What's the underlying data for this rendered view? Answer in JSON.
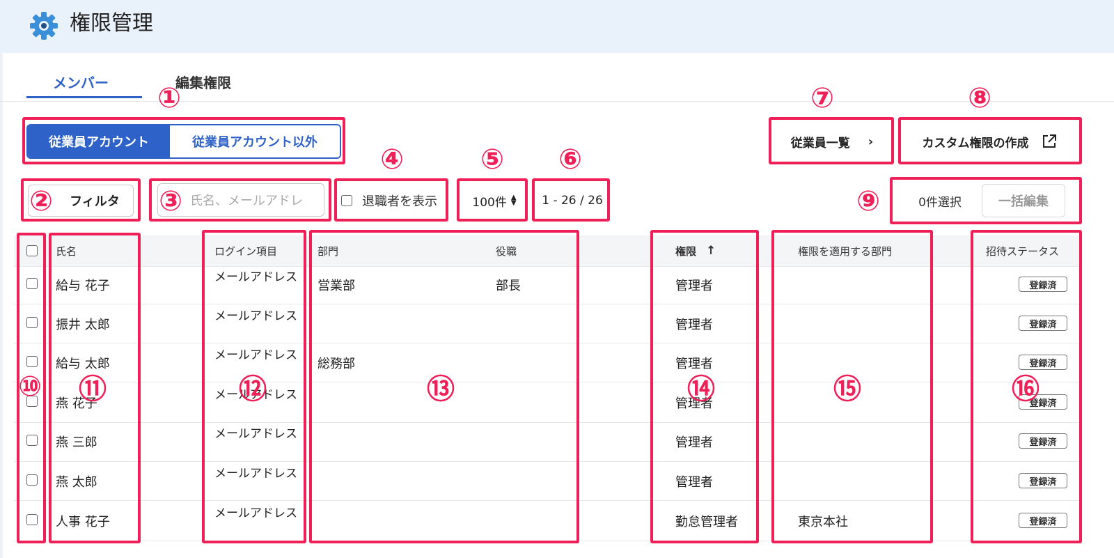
{
  "header": {
    "title": "権限管理",
    "icon": "gear-icon"
  },
  "tabs": [
    {
      "label": "メンバー",
      "active": true
    },
    {
      "label": "編集権限",
      "active": false
    }
  ],
  "account_toggle": {
    "options": [
      "従業員アカウント",
      "従業員アカウント以外"
    ],
    "selected": "従業員アカウント"
  },
  "toolbar": {
    "filter_label": "フィルタ",
    "search_placeholder": "氏名、メールアドレ",
    "show_retired_label": "退職者を表示",
    "per_page": "100件",
    "range": "1 - 26 / 26",
    "employee_list_label": "従業員一覧",
    "custom_permission_label": "カスタム権限の作成",
    "selected_count": "0件選択",
    "bulk_edit_label": "一括編集"
  },
  "table": {
    "columns": {
      "name": "氏名",
      "login": "ログイン項目",
      "department": "部門",
      "position": "役職",
      "permission": "権限",
      "applied_departments": "権限を適用する部門",
      "invite_status": "招待ステータス"
    },
    "rows": [
      {
        "name": "給与 花子",
        "login": "メールアドレス",
        "department": "営業部",
        "position": "部長",
        "permission": "管理者",
        "applied": "",
        "status": "登録済"
      },
      {
        "name": "振井 太郎",
        "login": "メールアドレス",
        "department": "",
        "position": "",
        "permission": "管理者",
        "applied": "",
        "status": "登録済"
      },
      {
        "name": "給与 太郎",
        "login": "メールアドレス",
        "department": "総務部",
        "position": "",
        "permission": "管理者",
        "applied": "",
        "status": "登録済"
      },
      {
        "name": "燕 花子",
        "login": "メールアドレス",
        "department": "",
        "position": "",
        "permission": "管理者",
        "applied": "",
        "status": "登録済"
      },
      {
        "name": "燕 三郎",
        "login": "メールアドレス",
        "department": "",
        "position": "",
        "permission": "管理者",
        "applied": "",
        "status": "登録済"
      },
      {
        "name": "燕 太郎",
        "login": "メールアドレス",
        "department": "",
        "position": "",
        "permission": "管理者",
        "applied": "",
        "status": "登録済"
      },
      {
        "name": "人事 花子",
        "login": "メールアドレス",
        "department": "",
        "position": "",
        "permission": "勤怠管理者",
        "applied": "東京本社",
        "status": "登録済"
      }
    ]
  },
  "annotations": [
    "①",
    "②",
    "③",
    "④",
    "⑤",
    "⑥",
    "⑦",
    "⑧",
    "⑨",
    "⑩",
    "⑪",
    "⑫",
    "⑬",
    "⑭",
    "⑮",
    "⑯"
  ],
  "colors": {
    "accent": "#2f62c8",
    "annotation": "#ef1f58",
    "header_bg": "#e9f1fb"
  }
}
